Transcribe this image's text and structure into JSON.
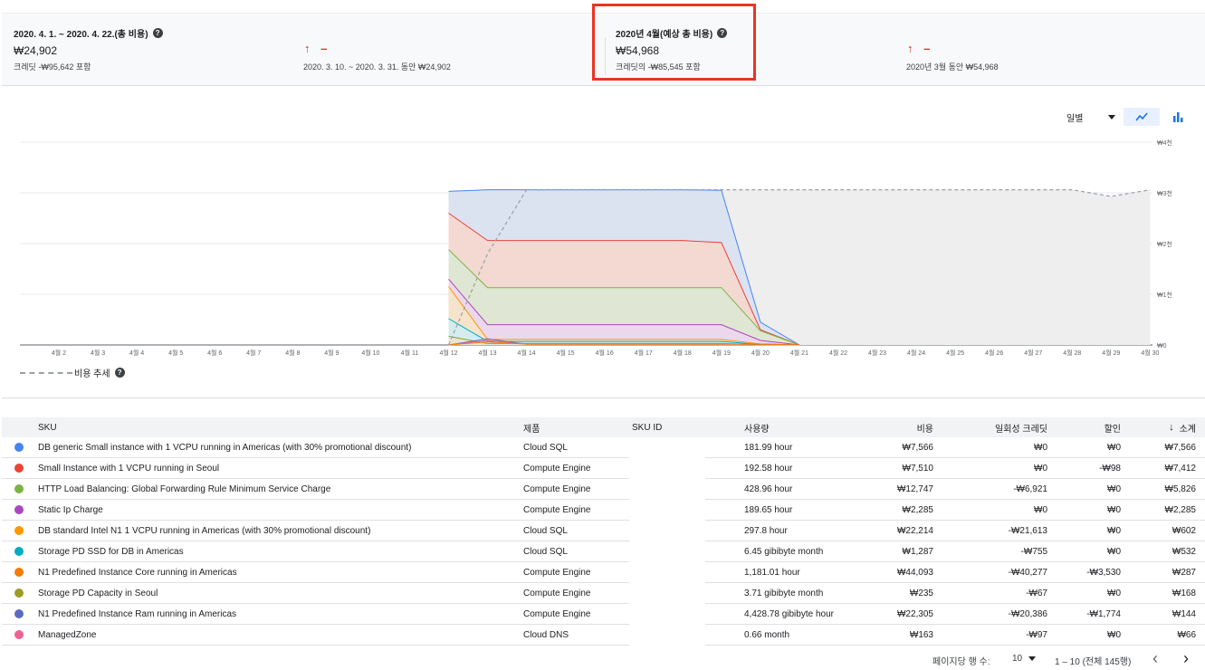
{
  "summary": {
    "period_title": "2020. 4. 1. ~ 2020. 4. 22.(총 비용)",
    "period_value": "₩24,902",
    "period_credit": "크레딧 -₩95,642 포함",
    "period_trend": "↑ –",
    "period_compare": "2020. 3. 10. ~ 2020. 3. 31. 동안 ₩24,902",
    "forecast_title": "2020년 4월(예상 총 비용)",
    "forecast_value": "₩54,968",
    "forecast_credit": "크레딧의 -₩85,545 포함",
    "forecast_trend": "↑ –",
    "forecast_compare": "2020년 3월 동안 ₩54,968",
    "help_icon": "?"
  },
  "controls": {
    "granularity": "일별",
    "view_line_icon": "line-chart-icon",
    "view_bar_icon": "bar-chart-icon"
  },
  "legend": {
    "trend_label": "비용 추세"
  },
  "colors": {
    "blue": "#4285f4",
    "red": "#ea4335",
    "green": "#7cb342",
    "purple": "#ab47bc",
    "orange": "#ff9800",
    "teal": "#00acc1",
    "dark_orange": "#f57c00",
    "olive": "#9e9d24",
    "indigo": "#5c6bc0",
    "pink": "#f06292",
    "highlight": "#ea3323",
    "forecast": "#9aa0a6"
  },
  "chart_data": {
    "type": "area",
    "x": [
      "4월 2",
      "4월 3",
      "4월 4",
      "4월 5",
      "4월 6",
      "4월 7",
      "4월 8",
      "4월 9",
      "4월 10",
      "4월 11",
      "4월 12",
      "4월 13",
      "4월 14",
      "4월 15",
      "4월 16",
      "4월 17",
      "4월 18",
      "4월 19",
      "4월 20",
      "4월 21",
      "4월 22",
      "4월 23",
      "4월 24",
      "4월 25",
      "4월 26",
      "4월 27",
      "4월 28",
      "4월 29",
      "4월 30"
    ],
    "y_ticks": [
      "₩0",
      "₩1천",
      "₩2천",
      "₩3천",
      "₩4천"
    ],
    "ylim": [
      0,
      4000
    ],
    "grid": true,
    "stack_start_index": 10,
    "stacked_totals": {
      "blue": [
        3030,
        3060,
        3060,
        3060,
        3060,
        3060,
        3060,
        3050,
        450,
        0
      ],
      "red": [
        2600,
        2060,
        2060,
        2060,
        2060,
        2060,
        2060,
        2020,
        300,
        0
      ],
      "green": [
        1880,
        1130,
        1130,
        1130,
        1130,
        1130,
        1130,
        1130,
        280,
        0
      ],
      "purple": [
        1300,
        400,
        400,
        400,
        400,
        400,
        400,
        400,
        90,
        0
      ],
      "orange": [
        1150,
        110,
        110,
        110,
        110,
        110,
        110,
        110,
        20,
        0
      ],
      "teal": [
        520,
        70,
        70,
        70,
        70,
        70,
        70,
        70,
        10,
        0
      ],
      "other": [
        170,
        30,
        30,
        30,
        30,
        30,
        30,
        30,
        5,
        0
      ]
    },
    "forecast": {
      "start_index": 10,
      "values": [
        0,
        1800,
        3060,
        3060,
        3060,
        3060,
        3060,
        3060,
        3060,
        3060,
        3060,
        3060,
        3060,
        3060,
        3060,
        3060,
        3060,
        2930,
        3060
      ]
    }
  },
  "table": {
    "headers": {
      "sku": "SKU",
      "product": "제품",
      "sku_id": "SKU ID",
      "usage": "사용량",
      "cost": "비용",
      "credit": "일회성 크레딧",
      "discount": "할인",
      "subtotal": "소계"
    },
    "rows": [
      {
        "color": "#4285f4",
        "sku": "DB generic Small instance with 1 VCPU running in Americas (with 30% promotional discount)",
        "product": "Cloud SQL",
        "usage": "181.99 hour",
        "cost": "₩7,566",
        "credit": "₩0",
        "discount": "₩0",
        "subtotal": "₩7,566"
      },
      {
        "color": "#ea4335",
        "sku": "Small Instance with 1 VCPU running in Seoul",
        "product": "Compute Engine",
        "usage": "192.58 hour",
        "cost": "₩7,510",
        "credit": "₩0",
        "discount": "-₩98",
        "subtotal": "₩7,412"
      },
      {
        "color": "#7cb342",
        "sku": "HTTP Load Balancing: Global Forwarding Rule Minimum Service Charge",
        "product": "Compute Engine",
        "usage": "428.96 hour",
        "cost": "₩12,747",
        "credit": "-₩6,921",
        "discount": "₩0",
        "subtotal": "₩5,826"
      },
      {
        "color": "#ab47bc",
        "sku": "Static Ip Charge",
        "product": "Compute Engine",
        "usage": "189.65 hour",
        "cost": "₩2,285",
        "credit": "₩0",
        "discount": "₩0",
        "subtotal": "₩2,285"
      },
      {
        "color": "#ff9800",
        "sku": "DB standard Intel N1 1 VCPU running in Americas (with 30% promotional discount)",
        "product": "Cloud SQL",
        "usage": "297.8 hour",
        "cost": "₩22,214",
        "credit": "-₩21,613",
        "discount": "₩0",
        "subtotal": "₩602"
      },
      {
        "color": "#00acc1",
        "sku": "Storage PD SSD for DB in Americas",
        "product": "Cloud SQL",
        "usage": "6.45 gibibyte month",
        "cost": "₩1,287",
        "credit": "-₩755",
        "discount": "₩0",
        "subtotal": "₩532"
      },
      {
        "color": "#f57c00",
        "sku": "N1 Predefined Instance Core running in Americas",
        "product": "Compute Engine",
        "usage": "1,181.01 hour",
        "cost": "₩44,093",
        "credit": "-₩40,277",
        "discount": "-₩3,530",
        "subtotal": "₩287"
      },
      {
        "color": "#9e9d24",
        "sku": "Storage PD Capacity in Seoul",
        "product": "Compute Engine",
        "usage": "3.71 gibibyte month",
        "cost": "₩235",
        "credit": "-₩67",
        "discount": "₩0",
        "subtotal": "₩168"
      },
      {
        "color": "#5c6bc0",
        "sku": "N1 Predefined Instance Ram running in Americas",
        "product": "Compute Engine",
        "usage": "4,428.78 gibibyte hour",
        "cost": "₩22,305",
        "credit": "-₩20,386",
        "discount": "-₩1,774",
        "subtotal": "₩144"
      },
      {
        "color": "#f06292",
        "sku": "ManagedZone",
        "product": "Cloud DNS",
        "usage": "0.66 month",
        "cost": "₩163",
        "credit": "-₩97",
        "discount": "₩0",
        "subtotal": "₩66"
      }
    ]
  },
  "pager": {
    "rows_label": "페이지당 행 수:",
    "rows_value": "10",
    "range": "1 – 10 (전체 145행)",
    "prev_icon": "‹",
    "next_icon": "›"
  }
}
